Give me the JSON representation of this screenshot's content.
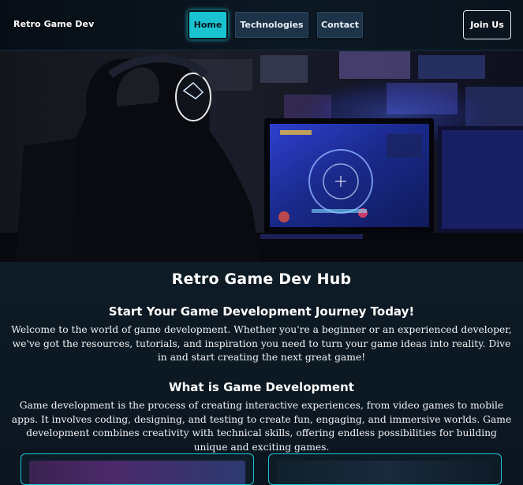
{
  "navbar": {
    "brand": "Retro Game Dev",
    "links": [
      "Home",
      "Technologies",
      "Contact"
    ],
    "active": "Home",
    "cta": "Join Us"
  },
  "main": {
    "title": "Retro Game Dev Hub",
    "intro_heading": "Start Your Game Development Journey Today!",
    "intro_text": "Welcome to the world of game development. Whether you're a beginner or an experienced developer, we've got the resources, tutorials, and inspiration you need to turn your game ideas into reality. Dive in and start creating the next great game!",
    "what_heading": "What is Game Development",
    "what_text": "Game development is the process of creating interactive experiences, from video games to mobile apps. It involves coding, designing, and testing to create fun, engaging, and immersive worlds. Game development combines creativity with technical skills, offering endless possibilities for building unique and exciting games."
  },
  "colors": {
    "accent": "#19c3cf",
    "background": "#0b1621",
    "nav_button": "#1d3348"
  }
}
